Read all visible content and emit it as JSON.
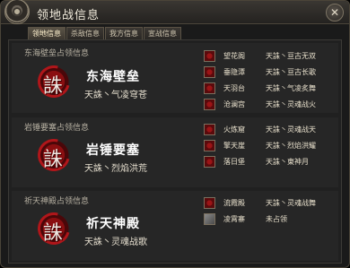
{
  "window": {
    "title": "领地战信息",
    "close_label": "✕"
  },
  "tabs": [
    {
      "label": "领地信息",
      "active": true
    },
    {
      "label": "杀敌信息",
      "active": false
    },
    {
      "label": "我方信息",
      "active": false
    },
    {
      "label": "宣战信息",
      "active": false
    }
  ],
  "sections": [
    {
      "title": "东海壁垒占领信息",
      "fort_name": "东海壁垒",
      "alliance": "天誅丶气凌穹苍",
      "occupants": [
        {
          "name": "望花阁",
          "alliance": "天誅丶亘古无双"
        },
        {
          "name": "垂隐潭",
          "alliance": "天誅丶亘古长歌"
        },
        {
          "name": "天羽台",
          "alliance": "天誅丶气凌炙舞"
        },
        {
          "name": "沧澜宫",
          "alliance": "天誅丶灵魂战火"
        }
      ]
    },
    {
      "title": "岩锤要塞占领信息",
      "fort_name": "岩锤要塞",
      "alliance": "天誅丶烈焰洪荒",
      "occupants": [
        {
          "name": "火炼窟",
          "alliance": "天誅丶灵魂战天"
        },
        {
          "name": "擎天崖",
          "alliance": "天誅丶烈焰洪耀"
        },
        {
          "name": "落日堡",
          "alliance": "天誅丶東神月"
        }
      ]
    },
    {
      "title": "祈天神殿占领信息",
      "fort_name": "祈天神殿",
      "alliance": "天誅丶灵魂战歌",
      "occupants": [
        {
          "name": "流霞殿",
          "alliance": "天誅丶灵魂战舞"
        },
        {
          "name": "凌霄寨",
          "alliance": "未占领"
        }
      ]
    }
  ],
  "emblem_glyph": "誅",
  "colors": {
    "seal_red": "#9b1416",
    "background": "#1a1a1a",
    "text": "#e8e2d0"
  }
}
